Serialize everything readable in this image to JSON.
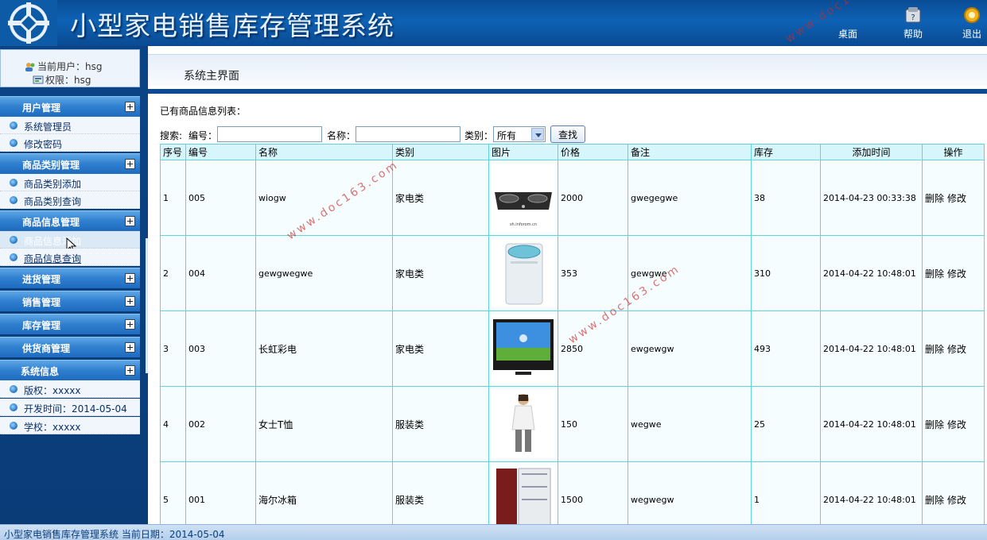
{
  "header": {
    "title": "小型家电销售库存管理系统",
    "buttons": [
      {
        "label": "桌面",
        "icon": "desktop-icon"
      },
      {
        "label": "帮助",
        "icon": "help-icon"
      },
      {
        "label": "退出",
        "icon": "exit-icon"
      }
    ]
  },
  "user": {
    "current_user": "当前用户：hsg",
    "permission": "权限：hsg"
  },
  "menu": {
    "user_mgmt": "用户管理",
    "sys_admin": "系统管理员",
    "change_pwd": "修改密码",
    "cat_mgmt": "商品类别管理",
    "cat_add": "商品类别添加",
    "cat_query": "商品类别查询",
    "goods_mgmt": "商品信息管理",
    "goods_add": "商品信息添加",
    "goods_query": "商品信息查询",
    "purchase_mgmt": "进货管理",
    "sales_mgmt": "销售管理",
    "stock_mgmt": "库存管理",
    "supplier_mgmt": "供货商管理",
    "sys_info": "系统信息",
    "copyright": "版权：xxxxx",
    "dev_time": "开发时间：2014-05-04",
    "school": "学校：xxxxx"
  },
  "main": {
    "tab_title": "系统主界面",
    "list_title": "已有商品信息列表：",
    "search": {
      "label": "搜索:",
      "code_label": "编号：",
      "code_value": "",
      "name_label": "名称：",
      "name_value": "",
      "type_label": "类别：",
      "type_selected": "所有",
      "button": "查找"
    },
    "columns": [
      "序号",
      "编号",
      "名称",
      "类别",
      "图片",
      "价格",
      "备注",
      "库存",
      "添加时间",
      "操作"
    ],
    "rows": [
      {
        "no": "1",
        "code": "005",
        "name": "wiogw",
        "type": "家电类",
        "image": "gas-stove",
        "price": "2000",
        "note": "gwegegwe",
        "stock": "38",
        "time": "2014-04-23 00:33:38"
      },
      {
        "no": "2",
        "code": "004",
        "name": "gewgwegwe",
        "type": "家电类",
        "image": "washing-machine",
        "price": "353",
        "note": "gewgwe",
        "stock": "310",
        "time": "2014-04-22 10:48:01"
      },
      {
        "no": "3",
        "code": "003",
        "name": "长虹彩电",
        "type": "家电类",
        "image": "tv",
        "price": "2850",
        "note": "ewgewgw",
        "stock": "493",
        "time": "2014-04-22 10:48:01"
      },
      {
        "no": "4",
        "code": "002",
        "name": "女士T恤",
        "type": "服装类",
        "image": "tshirt",
        "price": "150",
        "note": "wegwe",
        "stock": "25",
        "time": "2014-04-22 10:48:01"
      },
      {
        "no": "5",
        "code": "001",
        "name": "海尔冰箱",
        "type": "服装类",
        "image": "fridge",
        "price": "1500",
        "note": "wegwegw",
        "stock": "1",
        "time": "2014-04-22 10:48:01"
      }
    ],
    "ops": {
      "delete": "删除",
      "edit": "修改"
    }
  },
  "footer": {
    "text": "小型家电销售库存管理系统 当前日期：2014-05-04"
  },
  "watermark": "www.doc163.com"
}
